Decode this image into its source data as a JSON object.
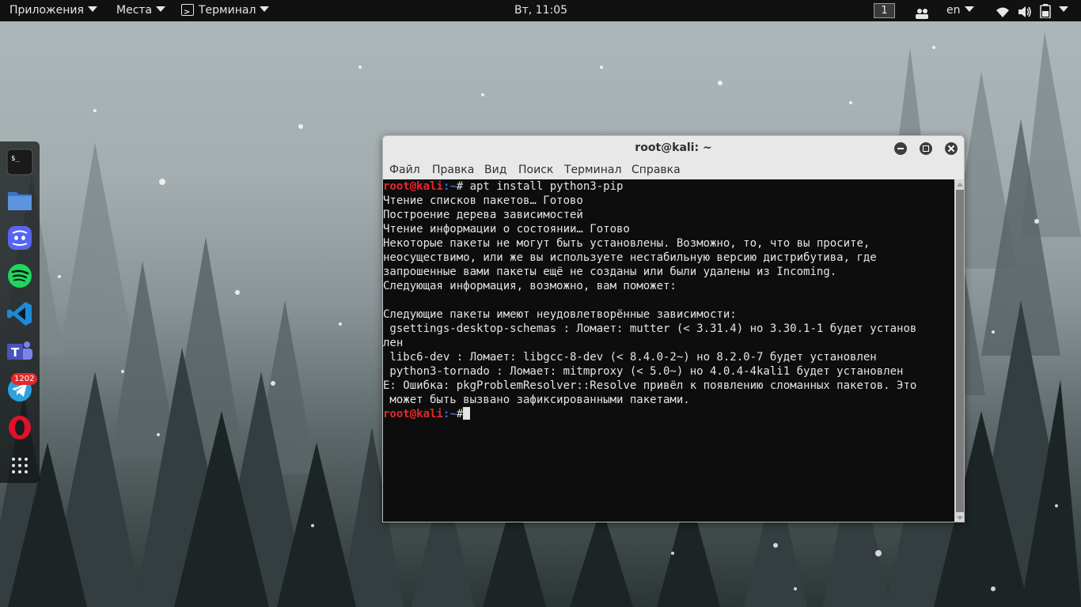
{
  "topbar": {
    "applications": "Приложения",
    "places": "Места",
    "active_app": "Терминал",
    "clock": "Вт, 11:05",
    "workspace": "1",
    "keyboard_layout": "en"
  },
  "dock": {
    "items": [
      {
        "name": "terminal",
        "icon": "terminal-icon"
      },
      {
        "name": "files",
        "icon": "folder-icon"
      },
      {
        "name": "discord",
        "icon": "discord-icon"
      },
      {
        "name": "spotify",
        "icon": "spotify-icon"
      },
      {
        "name": "vscode",
        "icon": "vscode-icon"
      },
      {
        "name": "teams",
        "icon": "teams-icon"
      },
      {
        "name": "telegram",
        "icon": "telegram-icon"
      },
      {
        "name": "opera",
        "icon": "opera-icon"
      },
      {
        "name": "show-apps",
        "icon": "grid-icon"
      }
    ],
    "telegram_badge": "1202"
  },
  "window": {
    "title": "root@kali: ~",
    "menu": [
      "Файл",
      "Правка",
      "Вид",
      "Поиск",
      "Терминал",
      "Справка"
    ],
    "prompt_user": "root@kali",
    "prompt_path": ":~",
    "prompt_symbol": "# ",
    "command": "apt install python3-pip",
    "output": [
      "Чтение списков пакетов… Готово",
      "Построение дерева зависимостей",
      "Чтение информации о состоянии… Готово",
      "Некоторые пакеты не могут быть установлены. Возможно, то, что вы просите,",
      "неосуществимо, или же вы используете нестабильную версию дистрибутива, где",
      "запрошенные вами пакеты ещё не созданы или были удалены из Incoming.",
      "Следующая информация, возможно, вам поможет:",
      "",
      "Следующие пакеты имеют неудовлетворённые зависимости:",
      " gsettings-desktop-schemas : Ломает: mutter (< 3.31.4) но 3.30.1-1 будет установ",
      "лен",
      " libc6-dev : Ломает: libgcc-8-dev (< 8.4.0-2~) но 8.2.0-7 будет установлен",
      " python3-tornado : Ломает: mitmproxy (< 5.0~) но 4.0.4-4kali1 будет установлен",
      "E: Ошибка: pkgProblemResolver::Resolve привёл к появлению сломанных пакетов. Это",
      " может быть вызвано зафиксированными пакетами."
    ],
    "prompt2_symbol": "#"
  },
  "colors": {
    "prompt_user": "#e8262a",
    "prompt_path": "#3d6fd6",
    "terminal_bg": "#0d0d0d",
    "terminal_fg": "#e4e4e4"
  }
}
